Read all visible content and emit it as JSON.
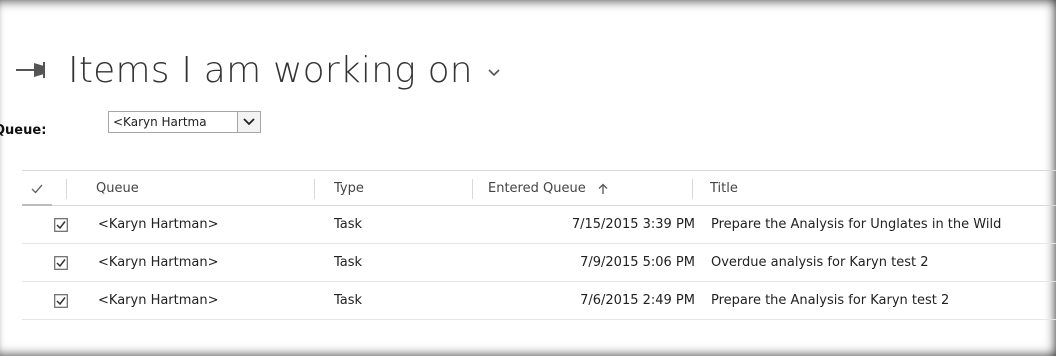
{
  "header": {
    "title": "Items I am working on"
  },
  "filter": {
    "queue_label": "Queue:",
    "queue_value": "<Karyn Hartma"
  },
  "grid": {
    "columns": {
      "queue": "Queue",
      "type": "Type",
      "entered_queue": "Entered Queue",
      "title": "Title"
    },
    "sort": {
      "column": "entered_queue",
      "direction": "ascending"
    },
    "rows": [
      {
        "checked": true,
        "queue": "<Karyn Hartman>",
        "type": "Task",
        "entered_queue": "7/15/2015 3:39 PM",
        "title": "Prepare the Analysis for Unglates in the Wild"
      },
      {
        "checked": true,
        "queue": "<Karyn Hartman>",
        "type": "Task",
        "entered_queue": "7/9/2015 5:06 PM",
        "title": "Overdue analysis for Karyn test 2"
      },
      {
        "checked": true,
        "queue": "<Karyn Hartman>",
        "type": "Task",
        "entered_queue": "7/6/2015 2:49 PM",
        "title": "Prepare the Analysis for Karyn test 2"
      }
    ]
  },
  "icons": {
    "pin": "pin-icon",
    "title_dropdown": "chevron-down-icon",
    "select_dropdown": "dropdown-arrow-icon",
    "select_all": "checkmark-icon",
    "sort": "sort-up-arrow-icon",
    "row_check": "checkbox-checked-icon"
  },
  "colors": {
    "text": "#222222",
    "title": "#333333",
    "gridline": "#d9d9d9"
  }
}
